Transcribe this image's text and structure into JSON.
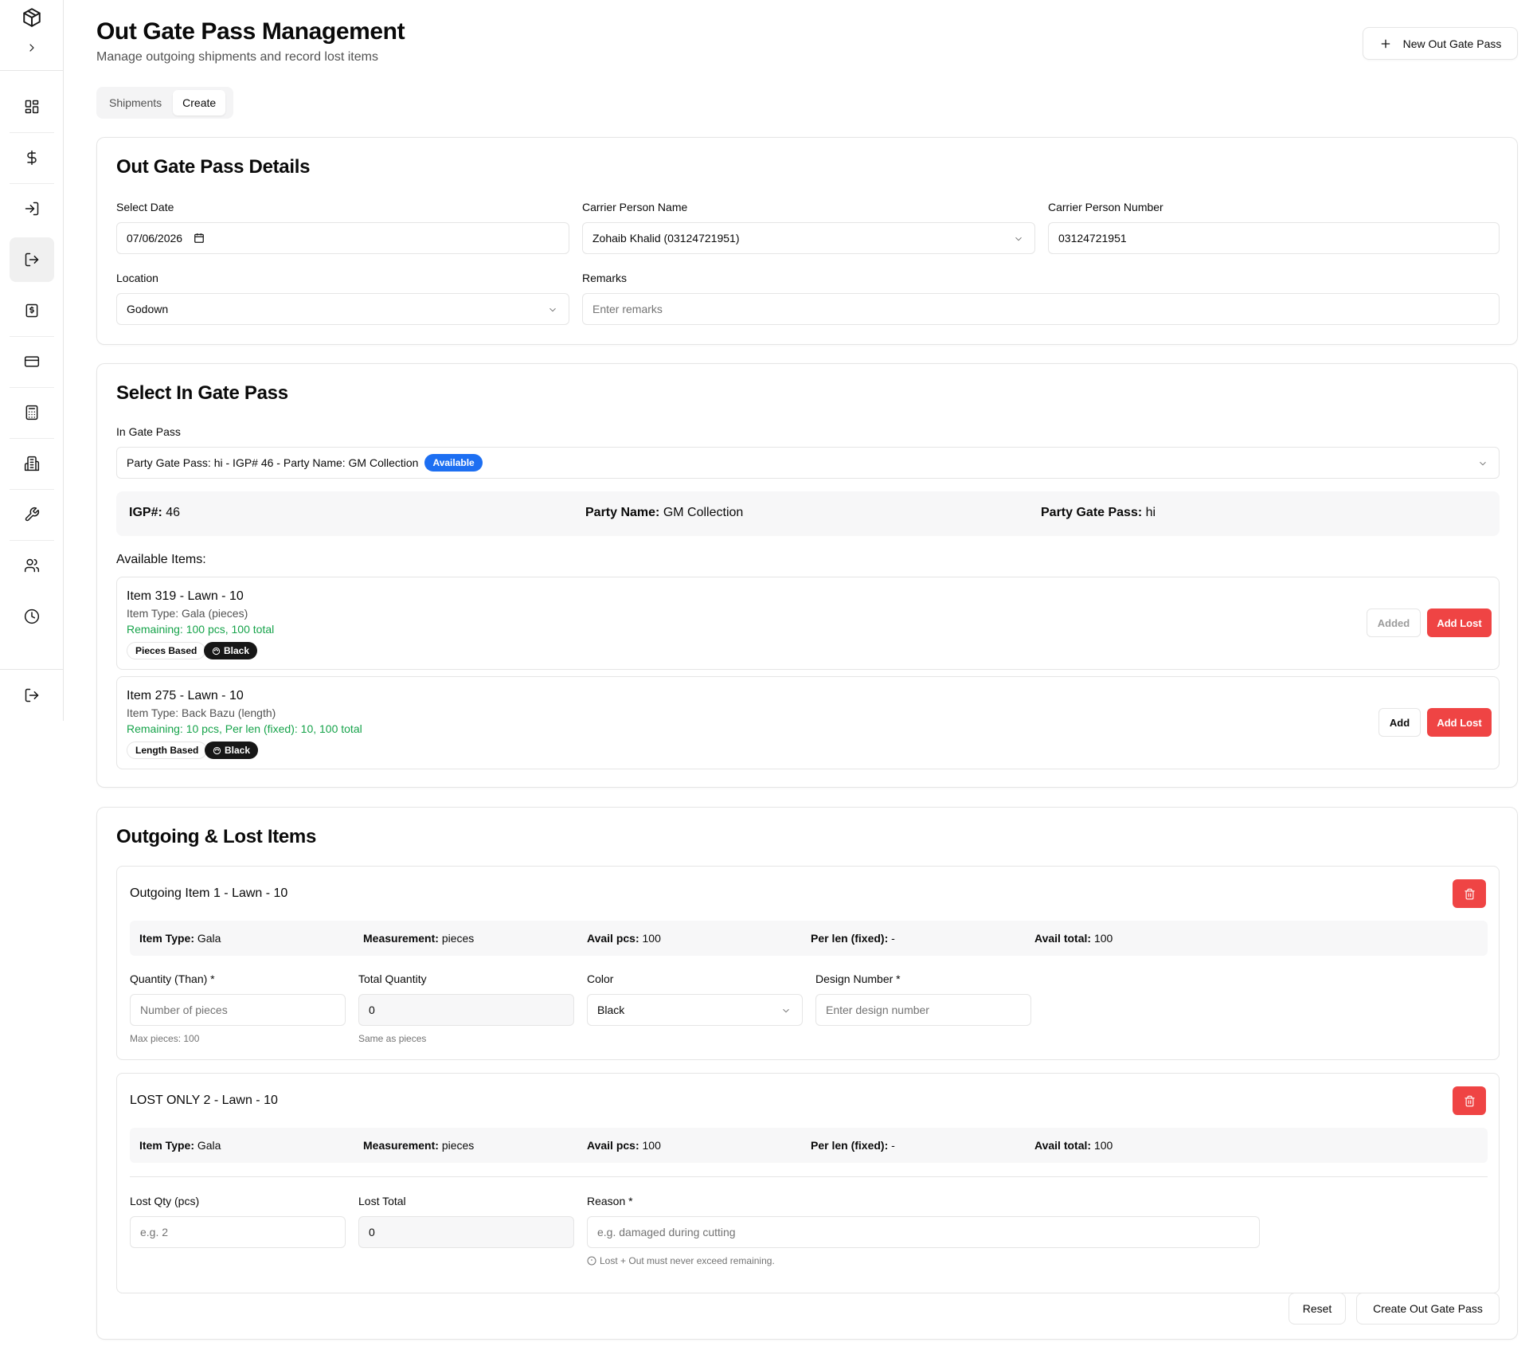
{
  "header": {
    "title": "Out Gate Pass Management",
    "subtitle": "Manage outgoing shipments and record lost items",
    "new_button": "New Out Gate Pass"
  },
  "tabs": [
    {
      "label": "Shipments",
      "active": false
    },
    {
      "label": "Create",
      "active": true
    }
  ],
  "sidebar": {
    "logo_icon": "package-icon",
    "expand_icon": "chevron-right-icon",
    "items": [
      {
        "icon": "dashboard-icon"
      },
      {
        "icon": "dollar-icon"
      },
      {
        "icon": "login-icon"
      },
      {
        "icon": "logout-icon",
        "active": true
      },
      {
        "icon": "receipt-icon"
      },
      {
        "icon": "credit-card-icon"
      },
      {
        "icon": "calculator-icon"
      },
      {
        "icon": "building-icon"
      },
      {
        "icon": "wrench-icon"
      },
      {
        "icon": "users-icon"
      },
      {
        "icon": "clock-icon"
      }
    ],
    "signout_icon": "sign-out-icon"
  },
  "details": {
    "title": "Out Gate Pass Details",
    "date_label": "Select Date",
    "date_value": "07/06/2026",
    "carrier_name_label": "Carrier Person Name",
    "carrier_name_value": "Zohaib Khalid (03124721951)",
    "carrier_number_label": "Carrier Person Number",
    "carrier_number_value": "03124721951",
    "location_label": "Location",
    "location_value": "Godown",
    "remarks_label": "Remarks",
    "remarks_placeholder": "Enter remarks"
  },
  "in_gate": {
    "title": "Select In Gate Pass",
    "label": "In Gate Pass",
    "selected": "Party Gate Pass: hi - IGP# 46 - Party Name: GM Collection",
    "badge": "Available",
    "igp_label": "IGP#:",
    "igp_value": "46",
    "party_label": "Party Name:",
    "party_value": "GM Collection",
    "pgp_label": "Party Gate Pass:",
    "pgp_value": "hi",
    "available_label": "Available Items:",
    "items": [
      {
        "title": "Item 319 - Lawn - 10",
        "type": "Item Type: Gala (pieces)",
        "remaining": "Remaining: 100 pcs, 100 total",
        "basis": "Pieces Based",
        "color": "Black",
        "add_label": "Added",
        "lost_label": "Add Lost"
      },
      {
        "title": "Item 275 - Lawn - 10",
        "type": "Item Type: Back Bazu (length)",
        "remaining": "Remaining: 10 pcs, Per len (fixed): 10, 100 total",
        "basis": "Length Based",
        "color": "Black",
        "add_label": "Add",
        "lost_label": "Add Lost"
      }
    ]
  },
  "outgoing": {
    "title": "Outgoing & Lost Items",
    "item1": {
      "title": "Outgoing Item 1 - Lawn - 10",
      "meta": {
        "item_type_label": "Item Type:",
        "item_type": "Gala",
        "measurement_label": "Measurement:",
        "measurement": "pieces",
        "avail_pcs_label": "Avail pcs:",
        "avail_pcs": "100",
        "per_len_label": "Per len (fixed):",
        "per_len": "-",
        "avail_total_label": "Avail total:",
        "avail_total": "100"
      },
      "qty_label": "Quantity (Than) *",
      "qty_placeholder": "Number of pieces",
      "qty_helper": "Max pieces: 100",
      "total_label": "Total Quantity",
      "total_value": "0",
      "total_helper": "Same as pieces",
      "color_label": "Color",
      "color_value": "Black",
      "design_label": "Design Number *",
      "design_placeholder": "Enter design number"
    },
    "item2": {
      "title": "LOST ONLY 2 - Lawn - 10",
      "meta": {
        "item_type_label": "Item Type:",
        "item_type": "Gala",
        "measurement_label": "Measurement:",
        "measurement": "pieces",
        "avail_pcs_label": "Avail pcs:",
        "avail_pcs": "100",
        "per_len_label": "Per len (fixed):",
        "per_len": "-",
        "avail_total_label": "Avail total:",
        "avail_total": "100"
      },
      "lost_qty_label": "Lost Qty (pcs)",
      "lost_qty_placeholder": "e.g. 2",
      "lost_total_label": "Lost Total",
      "lost_total_value": "0",
      "reason_label": "Reason *",
      "reason_placeholder": "e.g. damaged during cutting",
      "reason_helper": "Lost + Out must never exceed remaining."
    },
    "reset_label": "Reset",
    "create_label": "Create Out Gate Pass"
  }
}
